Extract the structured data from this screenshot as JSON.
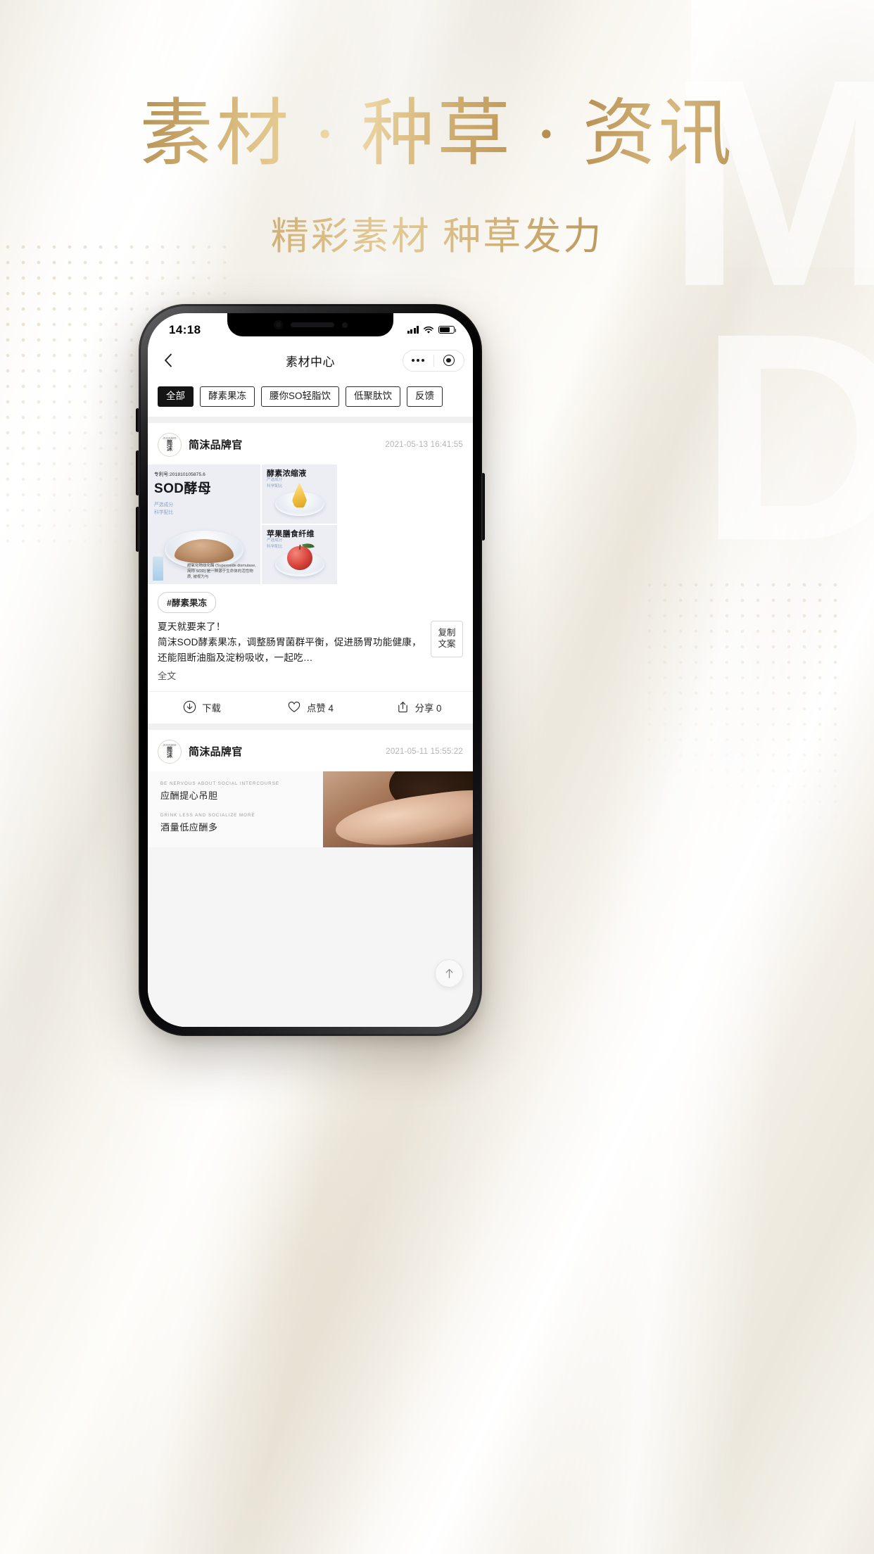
{
  "hero": {
    "title": "素材 · 种草 · 资讯",
    "subtitle": "精彩素材 种草发力",
    "watermark_line1": "M",
    "watermark_line2": "D"
  },
  "phone": {
    "status_bar": {
      "time": "14:18",
      "signal_icon": "cellular-signal-icon",
      "wifi_icon": "wifi-icon",
      "battery_icon": "battery-icon"
    },
    "app_header": {
      "back_icon": "back-chevron-icon",
      "title": "素材中心",
      "menu_icon": "more-dots-icon",
      "target_icon": "capsule-target-icon"
    },
    "filters": [
      {
        "label": "全部",
        "active": true
      },
      {
        "label": "酵素果冻",
        "active": false
      },
      {
        "label": "腰你SO轻脂饮",
        "active": false
      },
      {
        "label": "低聚肽饮",
        "active": false
      },
      {
        "label": "反馈",
        "active": false
      }
    ],
    "posts": [
      {
        "avatar_sup": "·",
        "avatar_line1": "简",
        "avatar_line2": "沫",
        "avatar_caption": "JIANMO",
        "author": "简沫品牌官",
        "timestamp": "2021-05-13 16:41:55",
        "media": {
          "main": {
            "patent": "专利号:201810105875.6",
            "headline": "SOD酵母",
            "sub_line1": "严选成分",
            "sub_line2": "科学配比",
            "footnote": "超氧化物歧化酶 (Superoxide dismutase, 简称 SOD) 是一种源于生命体的活性物质, 被视为与"
          },
          "tiles": [
            {
              "headline": "酵素浓缩液",
              "sub_line1": "严选成分",
              "sub_line2": "科学配比",
              "visual": "oil-drop"
            },
            {
              "headline": "苹果膳食纤维",
              "sub_line1": "严选成分",
              "sub_line2": "科学配比",
              "visual": "apple"
            }
          ]
        },
        "hashtag": "#酵素果冻",
        "caption": "夏天就要来了！\n简沫SOD酵素果冻，调整肠胃菌群平衡，促进肠胃功能健康，还能阻断油脂及淀粉吸收，一起吃…",
        "copy_button": "复制\n文案",
        "expand_label": "全文",
        "actions": [
          {
            "icon": "download-icon",
            "label": "下载"
          },
          {
            "icon": "heart-icon",
            "label": "点赞 4"
          },
          {
            "icon": "share-icon",
            "label": "分享 0"
          }
        ]
      },
      {
        "avatar_sup": "·",
        "avatar_line1": "简",
        "avatar_line2": "沫",
        "avatar_caption": "JIANMO",
        "author": "简沫品牌官",
        "timestamp": "2021-05-11 15:55:22",
        "media": {
          "en_line1": "BE NERVOUS ABOUT SOCIAL INTERCOURSE",
          "cn_line1": "应酬提心吊胆",
          "en_line2": "DRINK LESS AND SOCIALIZE MORE",
          "cn_line2": "酒量低应酬多"
        }
      }
    ],
    "scroll_top_icon": "scroll-to-top-icon"
  }
}
